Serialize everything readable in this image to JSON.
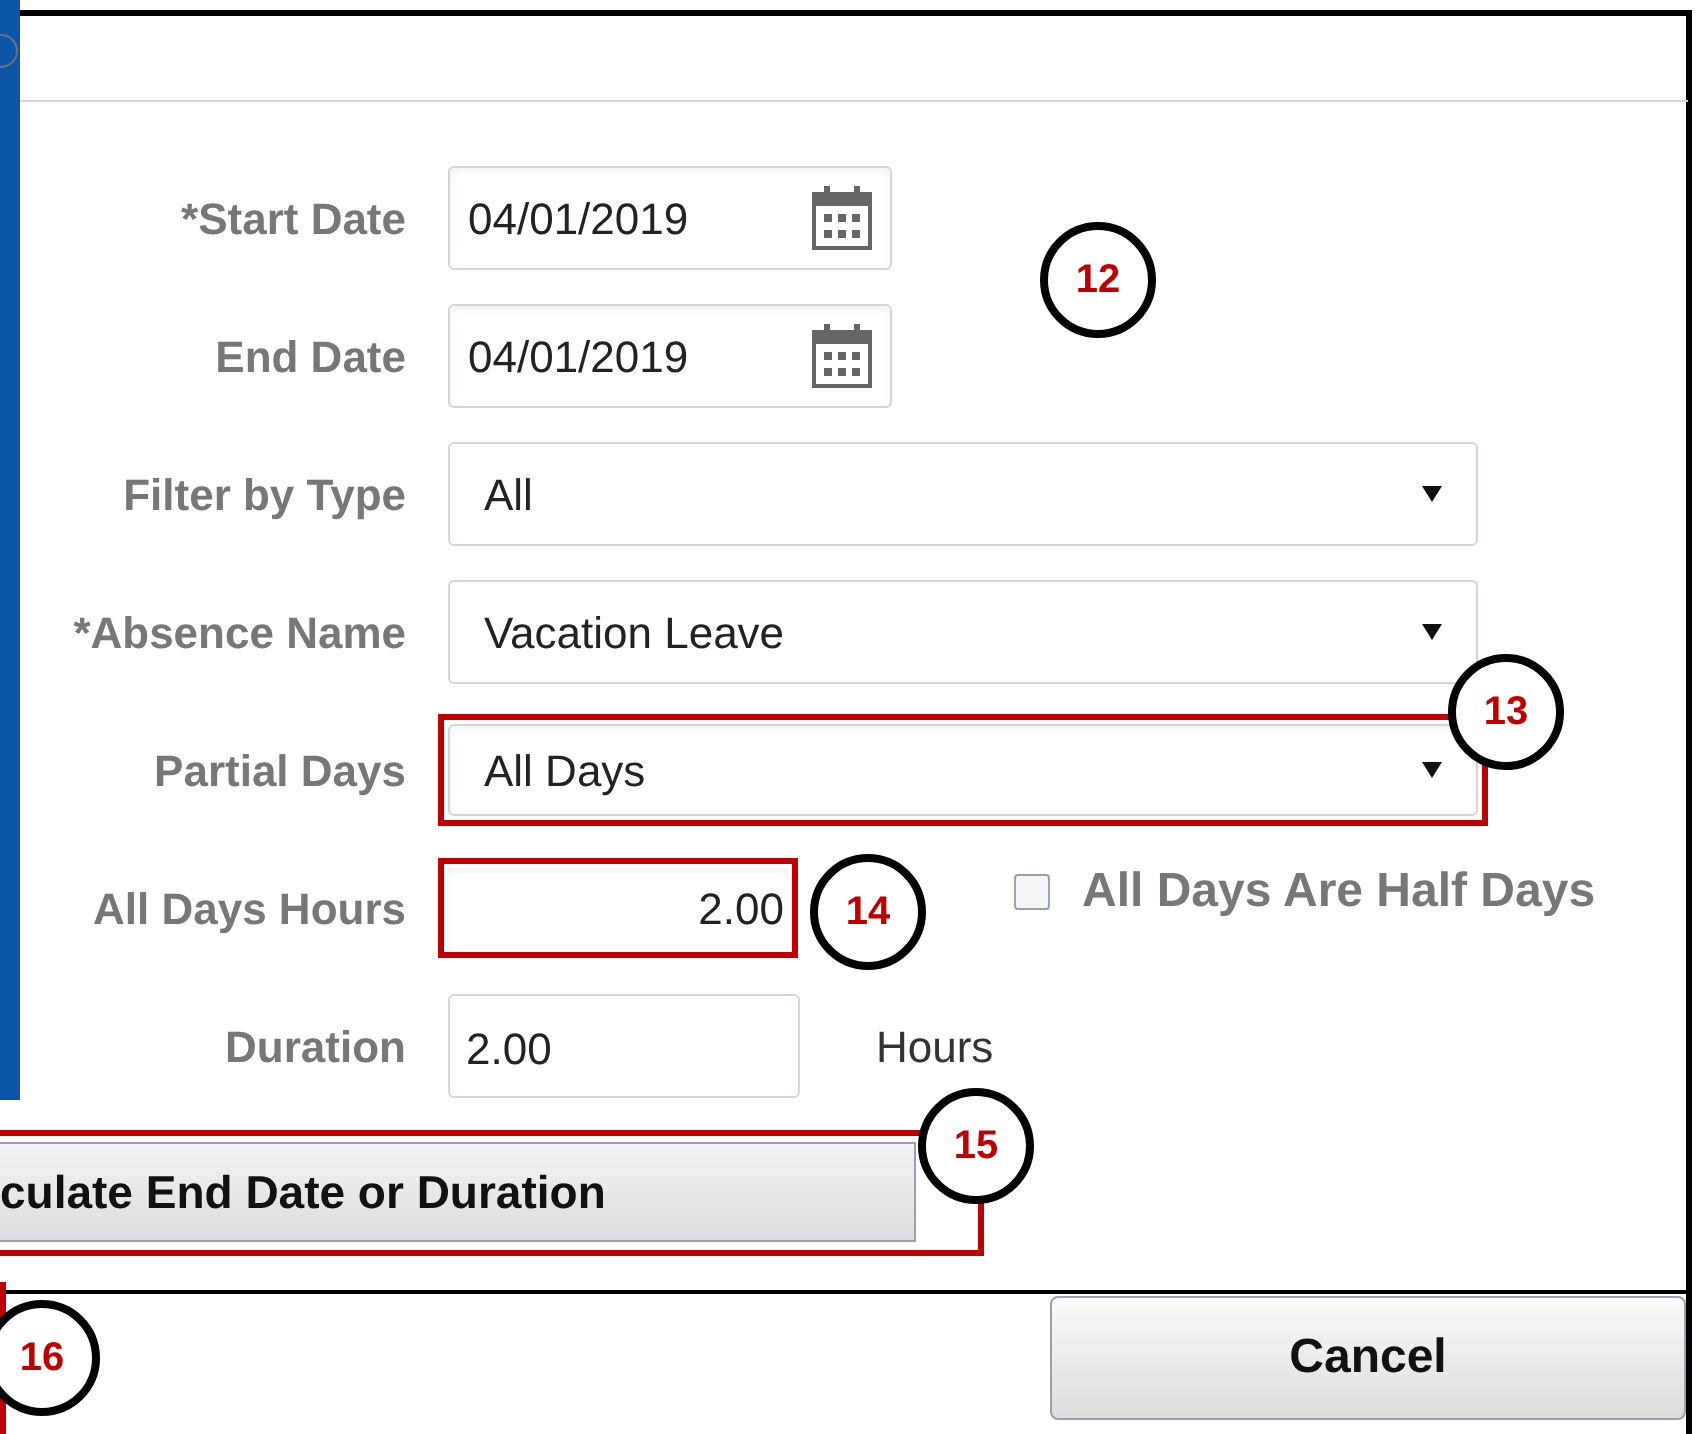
{
  "form": {
    "fields": [
      {
        "label": "*Start Date",
        "kind": "date",
        "value": "04/01/2019",
        "highlighted": false
      },
      {
        "label": "End Date",
        "kind": "date",
        "value": "04/01/2019",
        "highlighted": false
      },
      {
        "label": "Filter by Type",
        "kind": "select",
        "value": "All",
        "highlighted": false
      },
      {
        "label": "*Absence Name",
        "kind": "select",
        "value": "Vacation Leave",
        "highlighted": false
      },
      {
        "label": "Partial Days",
        "kind": "select",
        "value": "All Days",
        "highlighted": true
      },
      {
        "label": "All Days Hours",
        "kind": "number",
        "value": "2.00",
        "highlighted": true,
        "checkbox": {
          "label": "All Days Are Half Days",
          "checked": false
        }
      },
      {
        "label": "Duration",
        "kind": "text",
        "value": "2.00",
        "highlighted": false,
        "unit": "Hours"
      }
    ],
    "calculate_button": {
      "label": "culate End Date or Duration",
      "highlighted": true
    }
  },
  "footer": {
    "cancel_button": "Cancel"
  },
  "callouts": [
    "12",
    "13",
    "14",
    "15",
    "16"
  ]
}
